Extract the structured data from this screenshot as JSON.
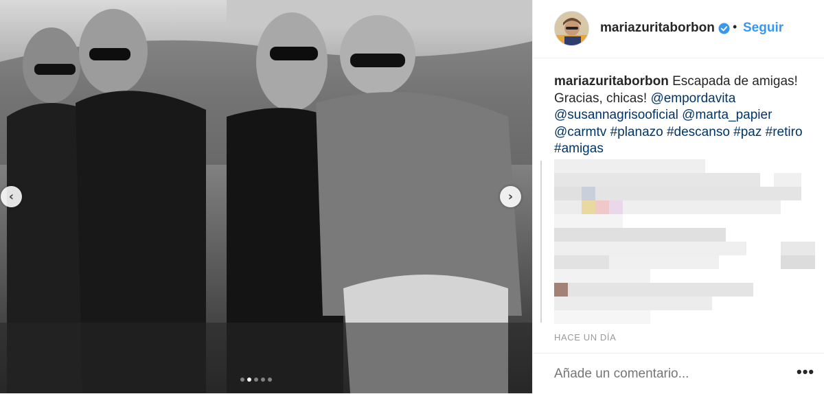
{
  "post": {
    "username": "mariazuritaborbon",
    "separator": "•",
    "follow_label": "Seguir",
    "caption_user": "mariazuritaborbon",
    "caption_text": "Escapada de amigas! Gracias, chicas!",
    "mentions": [
      "@empordavita",
      "@susannagrisooficial",
      "@marta_papier",
      "@carmtv"
    ],
    "hashtags": [
      "#planazo",
      "#descanso",
      "#paz",
      "#retiro",
      "#amigas"
    ],
    "timestamp": "HACE UN DÍA",
    "comment_placeholder": "Añade un comentario...",
    "more_label": "•••"
  },
  "carousel": {
    "prev_glyph": "‹",
    "next_glyph": "›",
    "slide_count": 5,
    "active_index": 1
  },
  "colors": {
    "link": "#003569",
    "follow": "#3897f0",
    "verified": "#3897f0",
    "muted": "#999999"
  }
}
